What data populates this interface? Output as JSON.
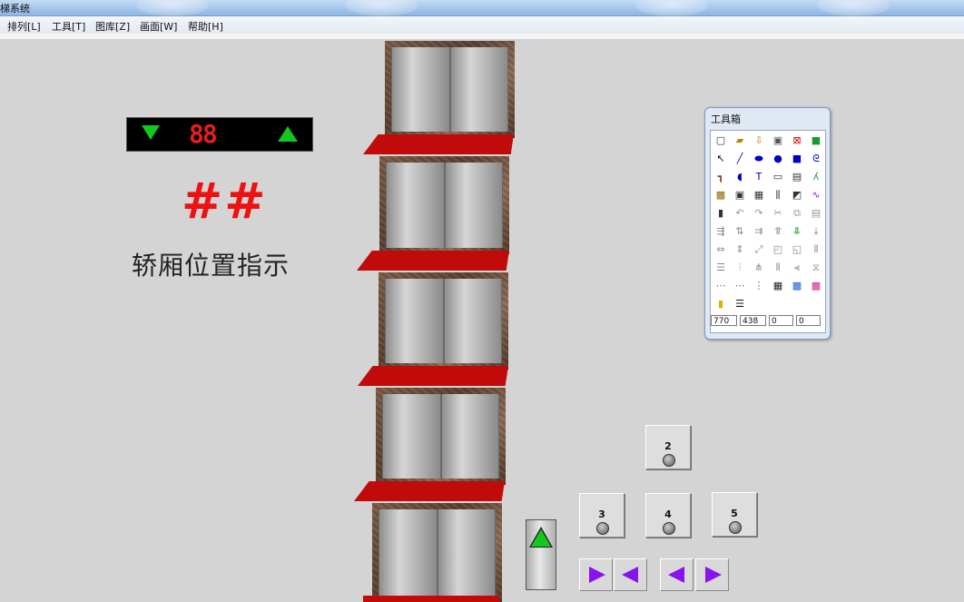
{
  "window": {
    "title": "梯系统"
  },
  "menu": [
    "排列[L]",
    "工具[T]",
    "图库[Z]",
    "画面[W]",
    "帮助[H]"
  ],
  "indicator": {
    "digits": "88",
    "down_color": "#13c81d",
    "up_color": "#13c81d",
    "digit_color": "#e21e1e"
  },
  "car_position": {
    "value": "##",
    "label": "轿厢位置指示"
  },
  "toolbox": {
    "title": "工具箱",
    "tools": [
      [
        "new-page-icon",
        "open-folder-icon",
        "import-icon",
        "save-disk-icon",
        "chart-icon",
        "green-screen-icon"
      ],
      [
        "pointer-icon",
        "line-icon",
        "ellipse-flat-icon",
        "filled-circle-icon",
        "filled-square-icon",
        "spiral-icon"
      ],
      [
        "pipe-icon",
        "pie-icon",
        "text-icon",
        "rounded-rect-icon",
        "document-icon",
        "curve-icon"
      ],
      [
        "image-icon",
        "frame-icon",
        "grid-icon",
        "chart-bars-icon",
        "trend-icon",
        "link-icon"
      ],
      [
        "device-icon",
        "undo-icon",
        "redo-icon",
        "cut-icon",
        "copy-icon",
        "paste-icon"
      ],
      [
        "align-left-icon",
        "align-center-icon",
        "align-right-icon",
        "align-top-icon",
        "align-middle-icon",
        "align-bottom-icon"
      ],
      [
        "same-width-icon",
        "same-height-icon",
        "same-size-icon",
        "front-icon",
        "back-icon",
        "group-icon"
      ],
      [
        "hspace-icon",
        "vspace-icon",
        "hcenter-icon",
        "vcenter-icon",
        "distribute-icon",
        "ungroup-icon"
      ],
      [
        "dots-h-icon",
        "dots-row-icon",
        "dots-v-icon",
        "grid-fine-icon",
        "palette-icon",
        "color-grid-icon"
      ],
      [
        "fill-color-icon",
        "line-style-icon"
      ]
    ],
    "coords": [
      "770",
      "438",
      "0",
      "0"
    ]
  },
  "call_buttons": [
    {
      "floor": "2"
    },
    {
      "floor": "3"
    },
    {
      "floor": "4"
    },
    {
      "floor": "5"
    }
  ],
  "colors": {
    "sill_red": "#c10a0a",
    "direction_purple": "#8a12ee",
    "arrow_green": "#13c81d"
  }
}
